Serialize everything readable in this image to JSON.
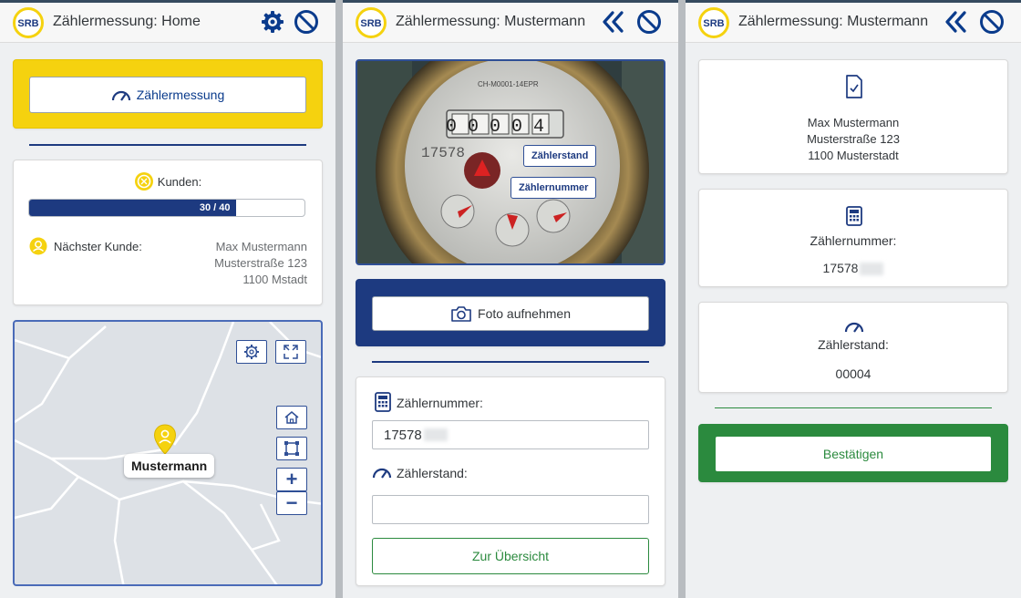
{
  "screens": {
    "home": {
      "title": "Zählermessung: Home",
      "logo_text": "SRB",
      "action_button": "Zählermessung",
      "customers_label": "Kunden:",
      "progress": {
        "current": 30,
        "total": 40,
        "text": "30 / 40"
      },
      "next_customer_label": "Nächster Kunde:",
      "next_customer": {
        "name": "Max Mustermann",
        "street": "Musterstraße 123",
        "city": "1100 Mstadt"
      },
      "map_marker_label": "Mustermann",
      "zoom_in": "+",
      "zoom_out": "−"
    },
    "capture": {
      "title": "Zählermessung: Mustermann",
      "logo_text": "SRB",
      "photo_tags": {
        "reading": "Zählerstand",
        "number": "Zählernummer"
      },
      "meter_digits": "00004",
      "meter_serial": "17578",
      "meter_model": "CH-M0001-14EPR",
      "take_photo_button": "Foto aufnehmen",
      "meter_number_label": "Zählernummer:",
      "meter_number_value": "17578",
      "meter_reading_label": "Zählerstand:",
      "meter_reading_value": "",
      "overview_button": "Zur Übersicht"
    },
    "summary": {
      "title": "Zählermessung: Mustermann",
      "logo_text": "SRB",
      "customer": {
        "name": "Max Mustermann",
        "street": "Musterstraße 123",
        "city": "1100 Musterstadt"
      },
      "meter_number_label": "Zählernummer:",
      "meter_number_value": "17578",
      "meter_reading_label": "Zählerstand:",
      "meter_reading_value": "00004",
      "confirm_button": "Bestätigen"
    }
  },
  "colors": {
    "brand_yellow": "#f5d20f",
    "brand_blue": "#1d3a80",
    "confirm_green": "#2b8a3e",
    "header_icon": "#0a3b8c"
  },
  "icons": [
    "srb-logo",
    "gear-icon",
    "block-icon",
    "double-chevron-left-icon",
    "gauge-icon",
    "customer-icon",
    "person-icon",
    "camera-icon",
    "calculator-icon",
    "document-icon",
    "home-icon",
    "fullscreen-icon",
    "map-marker-icon"
  ]
}
